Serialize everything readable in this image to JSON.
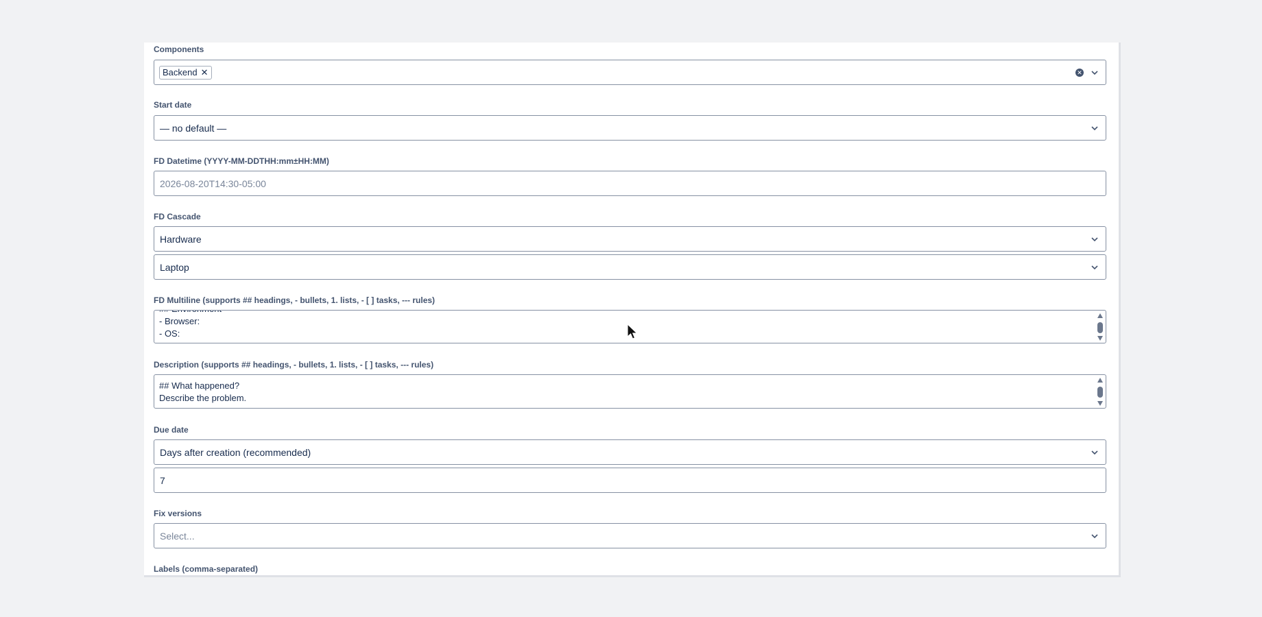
{
  "components": {
    "label": "Components",
    "chips": [
      "Backend"
    ]
  },
  "start_date": {
    "label": "Start date",
    "value": "— no default —"
  },
  "fd_datetime": {
    "label": "FD Datetime (YYYY-MM-DDTHH:mm±HH:MM)",
    "placeholder": "2026-08-20T14:30-05:00"
  },
  "fd_cascade": {
    "label": "FD Cascade",
    "parent": "Hardware",
    "child": "Laptop"
  },
  "fd_multiline": {
    "label": "FD Multiline (supports ## headings, - bullets, 1. lists, - [ ] tasks, --- rules)",
    "lines": [
      "## Environment",
      "- Browser:",
      "- OS:"
    ]
  },
  "description": {
    "label": "Description (supports ## headings, - bullets, 1. lists, - [ ] tasks, --- rules)",
    "lines": [
      "## What happened?",
      "Describe the problem."
    ]
  },
  "due_date": {
    "label": "Due date",
    "mode": "Days after creation (recommended)",
    "days": "7"
  },
  "fix_versions": {
    "label": "Fix versions",
    "placeholder": "Select..."
  },
  "labels_field": {
    "label": "Labels (comma-separated)"
  },
  "icons": {
    "chevron": "chevron-down-icon",
    "clear": "clear-icon",
    "remove": "close-icon",
    "cursor": "mouse-cursor-icon"
  }
}
